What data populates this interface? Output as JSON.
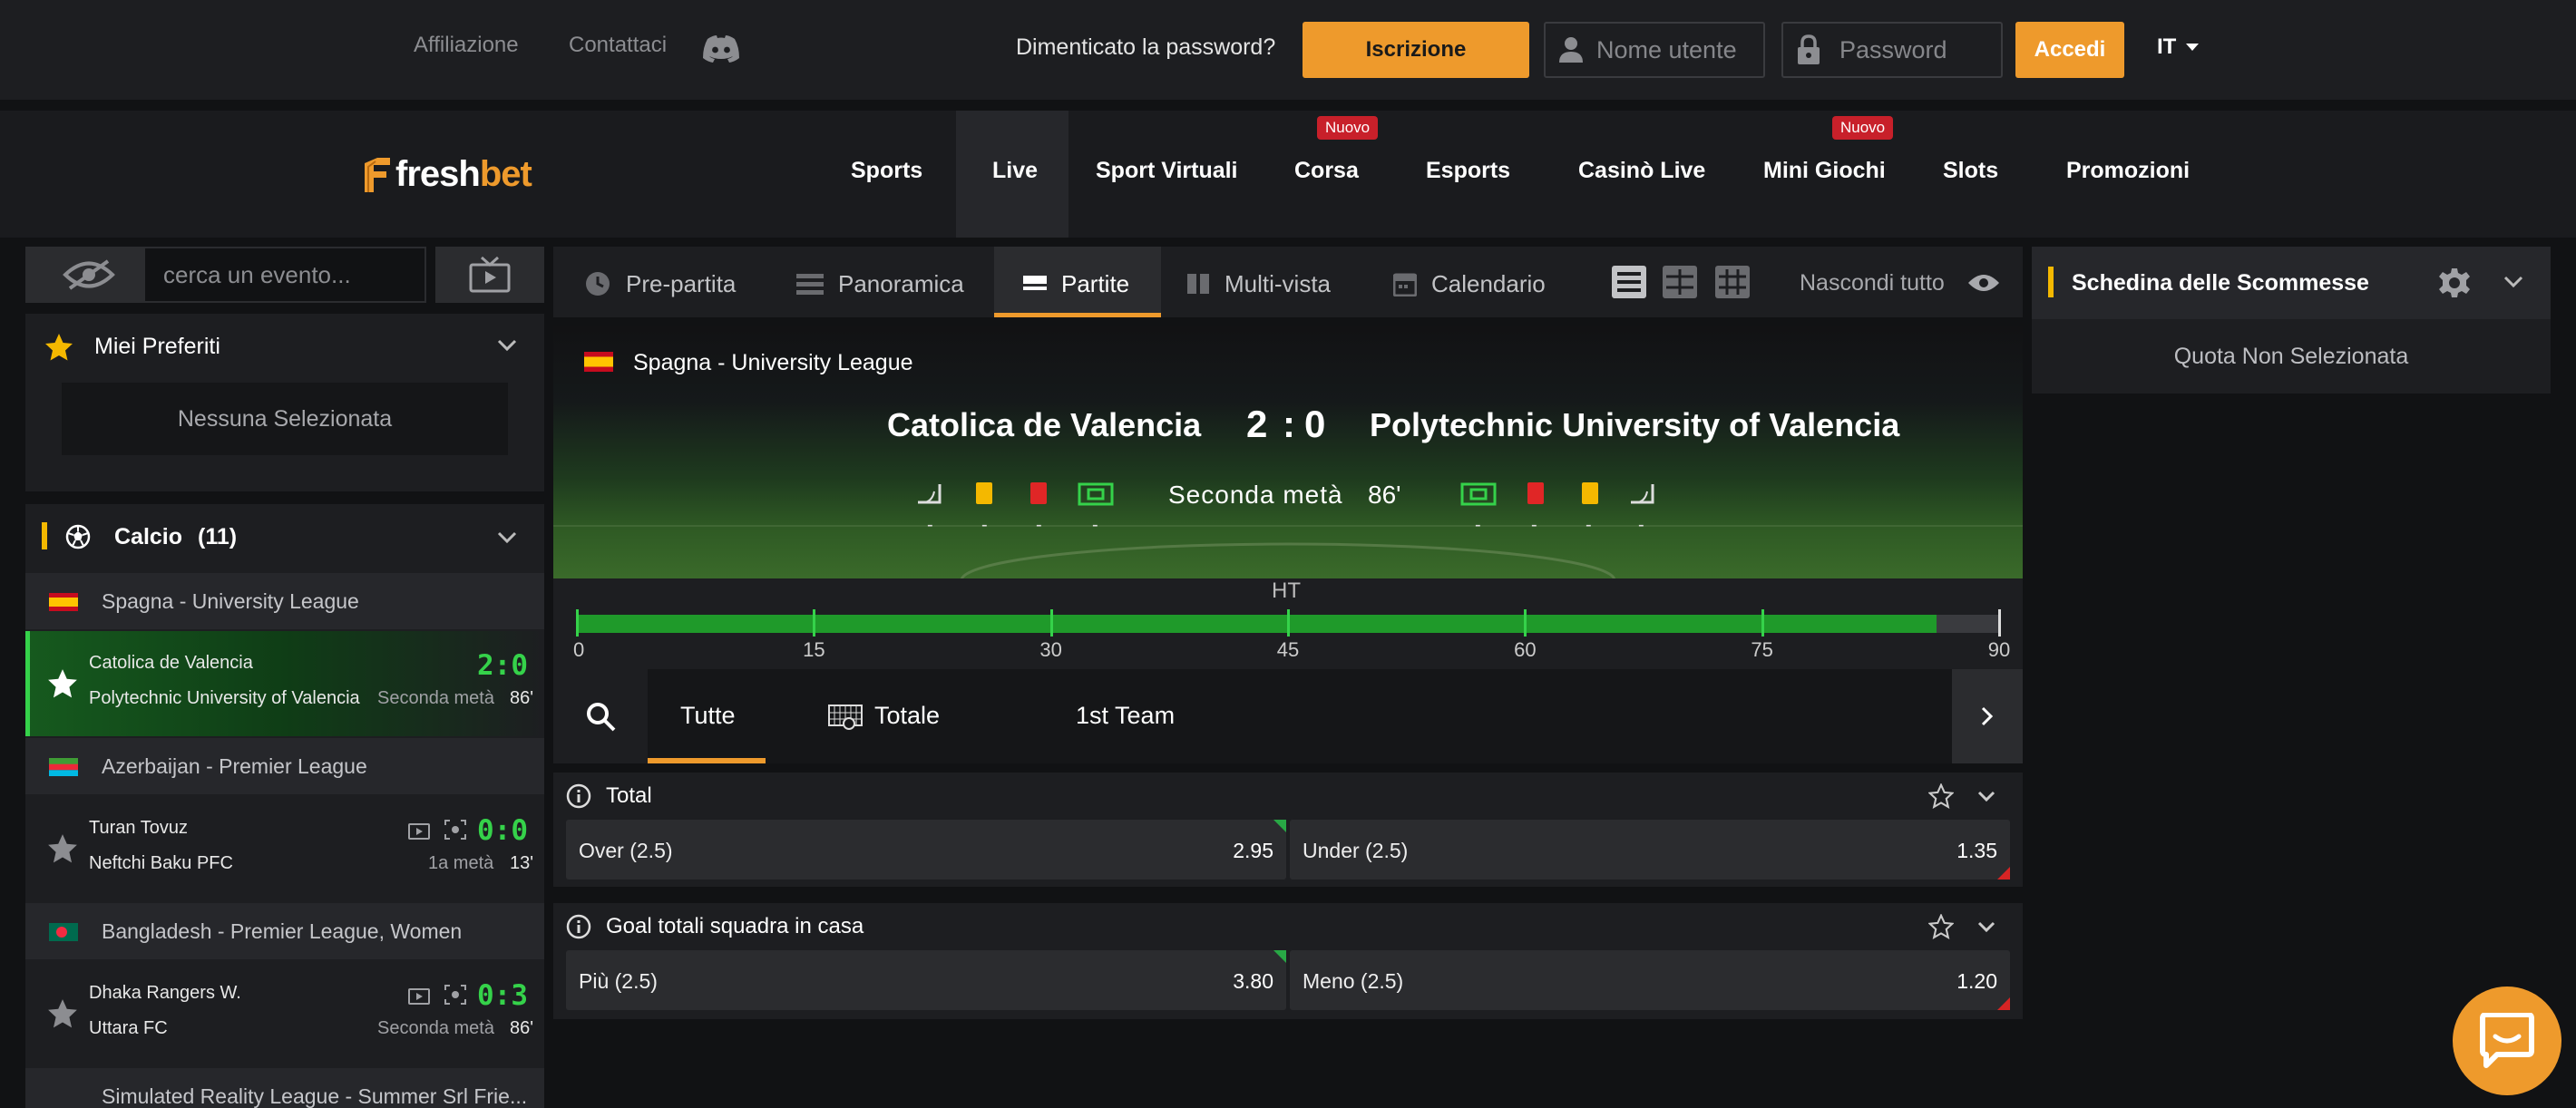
{
  "topbar": {
    "links": [
      "Affiliazione",
      "Contattaci"
    ],
    "forgot_password": "Dimenticato la password?",
    "register_label": "Iscrizione",
    "username_placeholder": "Nome utente",
    "password_placeholder": "Password",
    "login_label": "Accedi",
    "language": "IT"
  },
  "brand": {
    "logo": "freshbet",
    "accent": "#ee9a2c"
  },
  "nav": {
    "items": [
      "Sports",
      "Live",
      "Sport Virtuali",
      "Corsa",
      "Esports",
      "Casinò Live",
      "Mini Giochi",
      "Slots",
      "Promozioni"
    ],
    "active": "Live",
    "badge_corsa": "Nuovo",
    "badge_mini": "Nuovo"
  },
  "sidebar": {
    "search_placeholder": "cerca un evento...",
    "favorites_title": "Miei Preferiti",
    "favorites_empty": "Nessuna Selezionata",
    "sport_title": "Calcio",
    "sport_count": "(11)",
    "leagues": [
      {
        "name": "Spagna - University League",
        "match": {
          "home": "Catolica de Valencia",
          "away": "Polytechnic University of Valencia",
          "score": "2:0",
          "period": "Seconda metà",
          "minute": "86'"
        }
      },
      {
        "name": "Azerbaijan - Premier League",
        "match": {
          "home": "Turan Tovuz",
          "away": "Neftchi Baku PFC",
          "score": "0:0",
          "period": "1a metà",
          "minute": "13'"
        }
      },
      {
        "name": "Bangladesh - Premier League, Women",
        "match": {
          "home": "Dhaka Rangers W.",
          "away": "Uttara FC",
          "score": "0:3",
          "period": "Seconda metà",
          "minute": "86'"
        }
      },
      {
        "name": "Simulated Reality League - Summer Srl Frie..."
      }
    ]
  },
  "tabs": {
    "items": [
      "Pre-partita",
      "Panoramica",
      "Partite",
      "Multi-vista",
      "Calendario"
    ],
    "active": "Partite",
    "hide_all": "Nascondi tutto"
  },
  "match": {
    "league": "Spagna - University League",
    "home": "Catolica de Valencia",
    "away": "Polytechnic University of Valencia",
    "home_score": "2",
    "separator": ":",
    "away_score": "0",
    "period": "Seconda metà",
    "minute": "86'",
    "stat_dash": "-",
    "timeline": {
      "ht_label": "HT",
      "ticks": [
        "0",
        "15",
        "30",
        "45",
        "60",
        "75",
        "90"
      ],
      "progress": 0.956
    }
  },
  "market_tabs": {
    "items": [
      "Tutte",
      "Totale",
      "1st Team"
    ],
    "active": "Tutte"
  },
  "markets": [
    {
      "title": "Total",
      "outcomes": [
        {
          "label": "Over (2.5)",
          "odd": "2.95"
        },
        {
          "label": "Under (2.5)",
          "odd": "1.35"
        }
      ]
    },
    {
      "title": "Goal totali squadra in casa",
      "outcomes": [
        {
          "label": "Più (2.5)",
          "odd": "3.80"
        },
        {
          "label": "Meno (2.5)",
          "odd": "1.20"
        }
      ]
    }
  ],
  "betslip": {
    "title": "Schedina delle Scommesse",
    "empty": "Quota Non Selezionata"
  },
  "colors": {
    "live_green": "#35d24a",
    "progress_green": "#1f9a2a",
    "badge_red": "#c8202a"
  }
}
